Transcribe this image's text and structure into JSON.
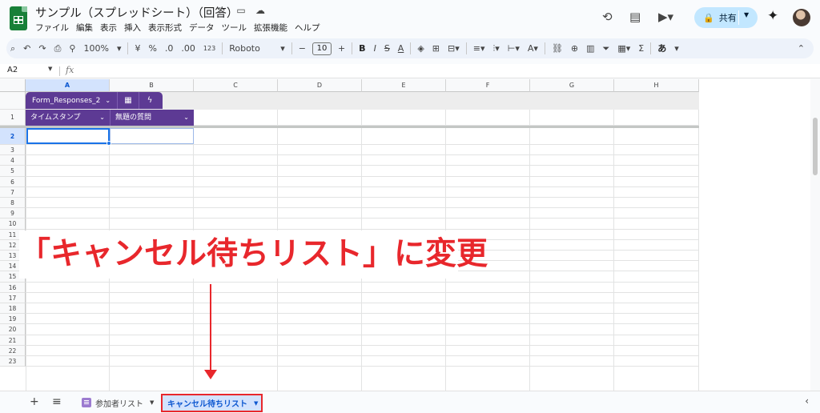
{
  "app": {
    "title": "サンプル（スプレッドシート）（回答）",
    "menu": [
      "ファイル",
      "編集",
      "表示",
      "挿入",
      "表示形式",
      "データ",
      "ツール",
      "拡張機能",
      "ヘルプ"
    ],
    "share_label": "共有",
    "accent": "#0b57d0"
  },
  "toolbar": {
    "zoom": "100%",
    "currency": "¥",
    "percent": "%",
    "dec_decrease": ".0",
    "dec_increase": ".00",
    "number_format": "123",
    "font": "Roboto",
    "font_size": "10",
    "bold": "B",
    "italic": "I",
    "input_tool": "あ"
  },
  "formula_bar": {
    "name_box": "A2",
    "fx": "fx"
  },
  "grid": {
    "columns": [
      "A",
      "B",
      "C",
      "D",
      "E",
      "F",
      "G",
      "H"
    ],
    "rows": [
      "1",
      "2",
      "3",
      "4",
      "5",
      "6",
      "7",
      "8",
      "9",
      "10",
      "11",
      "12",
      "13",
      "14",
      "15",
      "16",
      "17",
      "18",
      "19",
      "20",
      "21",
      "22",
      "23"
    ],
    "selected_cell": "A2"
  },
  "table": {
    "name": "Form_Responses_2",
    "headers": [
      "タイムスタンプ",
      "無題の質問"
    ],
    "color": "#5d3a94"
  },
  "annotation": {
    "text": "「キャンセル待ちリスト」に変更",
    "color": "#e8272c"
  },
  "sheets": {
    "tabs": [
      "参加者リスト",
      "キャンセル待ちリスト"
    ],
    "active": "キャンセル待ちリスト"
  }
}
